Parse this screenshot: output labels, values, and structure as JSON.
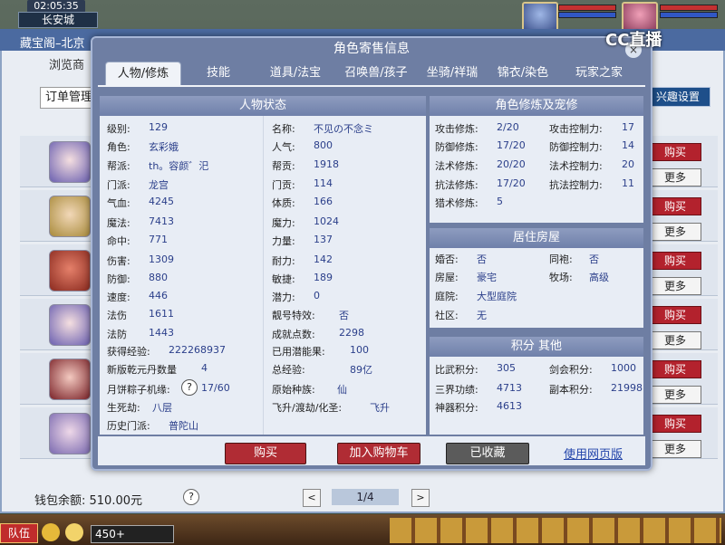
{
  "hud": {
    "clock": "02:05:35",
    "location": "长安城",
    "stream_logo": "CC直播"
  },
  "store": {
    "title": "藏宝阁–北京",
    "tab_browse": "浏览商",
    "btn_orders": "订单管理",
    "btn_settings": "兴趣设置",
    "buy_label": "购买",
    "more_label": "更多",
    "wallet": "钱包余额: 510.00元",
    "help": "?",
    "page": "1/4",
    "prev": "<",
    "next": ">"
  },
  "taskbar": {
    "team": "队伍",
    "coins": "450+"
  },
  "dialog": {
    "title": "角色寄售信息",
    "close": "×",
    "tabs": [
      "人物/修炼",
      "技能",
      "道具/法宝",
      "召唤兽/孩子",
      "坐骑/祥瑞",
      "锦衣/染色",
      "玩家之家"
    ],
    "status_head": "人物状态",
    "status_left": [
      {
        "label": "级别:",
        "value": "129"
      },
      {
        "label": "角色:",
        "value": "玄彩娥"
      },
      {
        "label": "帮派:",
        "value": "th。容颜゛汜"
      },
      {
        "label": "门派:",
        "value": "龙宫"
      },
      {
        "label": "气血:",
        "value": "4245"
      },
      {
        "label": "魔法:",
        "value": "7413"
      },
      {
        "label": "命中:",
        "value": "771"
      },
      {
        "label": "伤害:",
        "value": "1309"
      },
      {
        "label": "防御:",
        "value": "880"
      },
      {
        "label": "速度:",
        "value": "446"
      },
      {
        "label": "法伤",
        "value": "1611"
      },
      {
        "label": "法防",
        "value": "1443"
      },
      {
        "label": "获得经验:",
        "value": "222268937"
      },
      {
        "label": "新版乾元丹数量",
        "value": "4"
      },
      {
        "label": "月饼粽子机缘:",
        "value": "17/60"
      },
      {
        "label": "生死劫:",
        "value": "八层"
      },
      {
        "label": "历史门派:",
        "value": "普陀山"
      }
    ],
    "status_right": [
      {
        "label": "名称:",
        "value": "不见の不念ミ"
      },
      {
        "label": "人气:",
        "value": "800"
      },
      {
        "label": "帮贡:",
        "value": "1918"
      },
      {
        "label": "门贡:",
        "value": "114"
      },
      {
        "label": "体质:",
        "value": "166"
      },
      {
        "label": "魔力:",
        "value": "1024"
      },
      {
        "label": "力量:",
        "value": "137"
      },
      {
        "label": "耐力:",
        "value": "142"
      },
      {
        "label": "敏捷:",
        "value": "189"
      },
      {
        "label": "潜力:",
        "value": "0"
      },
      {
        "label": "靓号特效:",
        "value": "否"
      },
      {
        "label": "成就点数:",
        "value": "2298"
      },
      {
        "label": "已用潜能果:",
        "value": "100"
      },
      {
        "label": "总经验:",
        "value": "89亿"
      },
      {
        "label": "原始种族:",
        "value": "仙"
      },
      {
        "label": "飞升/渡劫/化圣:",
        "value": "飞升"
      }
    ],
    "cultivation_head": "角色修炼及宠修",
    "cultivation": [
      {
        "l1": "攻击修炼:",
        "v1": "2/20",
        "l2": "攻击控制力:",
        "v2": "17"
      },
      {
        "l1": "防御修炼:",
        "v1": "17/20",
        "l2": "防御控制力:",
        "v2": "14"
      },
      {
        "l1": "法术修炼:",
        "v1": "20/20",
        "l2": "法术控制力:",
        "v2": "20"
      },
      {
        "l1": "抗法修炼:",
        "v1": "17/20",
        "l2": "抗法控制力:",
        "v2": "11"
      },
      {
        "l1": "猎术修炼:",
        "v1": "5",
        "l2": "",
        "v2": ""
      }
    ],
    "house_head": "居住房屋",
    "house": [
      {
        "l1": "婚否:",
        "v1": "否",
        "l2": "同袍:",
        "v2": "否"
      },
      {
        "l1": "房屋:",
        "v1": "豪宅",
        "l2": "牧场:",
        "v2": "高级"
      },
      {
        "l1": "庭院:",
        "v1": "大型庭院",
        "l2": "",
        "v2": ""
      },
      {
        "l1": "社区:",
        "v1": "无",
        "l2": "",
        "v2": ""
      }
    ],
    "score_head": "积分 其他",
    "score": [
      {
        "l1": "比武积分:",
        "v1": "305",
        "l2": "剑会积分:",
        "v2": "1000"
      },
      {
        "l1": "三界功绩:",
        "v1": "4713",
        "l2": "副本积分:",
        "v2": "21998"
      },
      {
        "l1": "神器积分:",
        "v1": "4613",
        "l2": "",
        "v2": ""
      }
    ],
    "qmark": "?",
    "buttons": {
      "buy": "购买",
      "cart": "加入购物车",
      "favorited": "已收藏",
      "web": "使用网页版"
    }
  },
  "colors": {
    "accent_red": "#b02c34",
    "panel_bg": "#e8edf5",
    "header_blue": "#6f80aa",
    "value_blue": "#2b3f8a"
  }
}
